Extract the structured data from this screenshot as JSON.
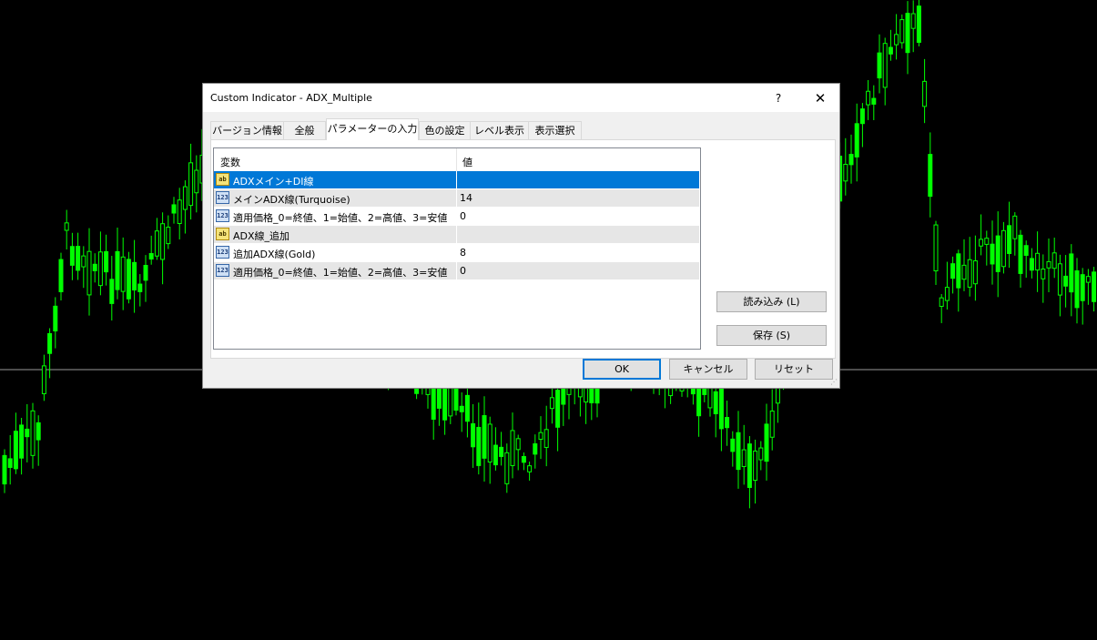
{
  "window": {
    "title": "Custom Indicator - ADX_Multiple",
    "help_label": "?",
    "close_label": "✕"
  },
  "tabs": [
    {
      "label": "バージョン情報"
    },
    {
      "label": "全般"
    },
    {
      "label": "パラメーターの入力"
    },
    {
      "label": "色の設定"
    },
    {
      "label": "レベル表示"
    },
    {
      "label": "表示選択"
    }
  ],
  "active_tab": "パラメーターの入力",
  "grid": {
    "col_name": "変数",
    "col_value": "値",
    "rows": [
      {
        "icon": "ab",
        "name": "ADXメイン+DI線",
        "value": ""
      },
      {
        "icon": "123",
        "name": "メインADX線(Turquoise)",
        "value": "14"
      },
      {
        "icon": "123",
        "name": "適用価格_0=終値、1=始値、2=高値、3=安値",
        "value": "0"
      },
      {
        "icon": "ab",
        "name": "ADX線_追加",
        "value": ""
      },
      {
        "icon": "123",
        "name": "追加ADX線(Gold)",
        "value": "8"
      },
      {
        "icon": "123",
        "name": "適用価格_0=終値、1=始値、2=高値、3=安値",
        "value": "0"
      }
    ]
  },
  "buttons": {
    "load": "読み込み (L)",
    "save": "保存 (S)",
    "ok": "OK",
    "cancel": "キャンセル",
    "reset": "リセット"
  },
  "colors": {
    "chart_background": "#000000",
    "candle": "#00ff00",
    "selection": "#0078d7"
  }
}
